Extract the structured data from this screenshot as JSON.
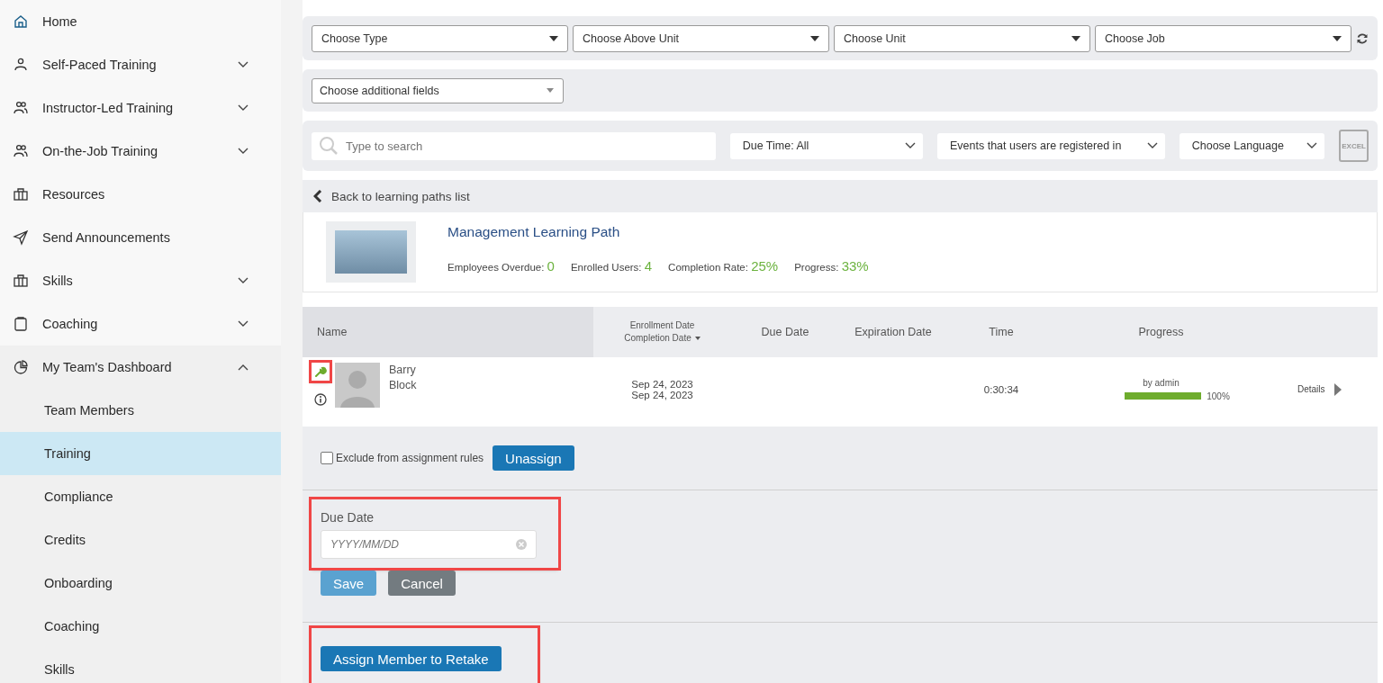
{
  "sidebar": {
    "items": [
      {
        "label": "Home",
        "kind": "link"
      },
      {
        "label": "Self-Paced Training",
        "kind": "group",
        "expanded": false
      },
      {
        "label": "Instructor-Led Training",
        "kind": "group",
        "expanded": false
      },
      {
        "label": "On-the-Job Training",
        "kind": "group",
        "expanded": false
      },
      {
        "label": "Resources",
        "kind": "link"
      },
      {
        "label": "Send Announcements",
        "kind": "link"
      },
      {
        "label": "Skills",
        "kind": "group",
        "expanded": false
      },
      {
        "label": "Coaching",
        "kind": "group",
        "expanded": false
      },
      {
        "label": "My Team's Dashboard",
        "kind": "group",
        "expanded": true,
        "children": [
          {
            "label": "Team Members",
            "selected": false
          },
          {
            "label": "Training",
            "selected": true
          },
          {
            "label": "Compliance",
            "selected": false
          },
          {
            "label": "Credits",
            "selected": false
          },
          {
            "label": "Onboarding",
            "selected": false
          },
          {
            "label": "Coaching",
            "selected": false
          },
          {
            "label": "Skills",
            "selected": false
          }
        ]
      }
    ]
  },
  "filters": [
    "Choose Type",
    "Choose Above Unit",
    "Choose Unit",
    "Choose Job"
  ],
  "additional_fields": "Choose additional fields",
  "search": {
    "placeholder": "Type to search"
  },
  "selects": [
    "Due Time: All",
    "Events that users are registered in",
    "Choose Language"
  ],
  "export_label": "EXCEL",
  "back_link": "Back to learning paths list",
  "path": {
    "title": "Management Learning Path",
    "stats": [
      {
        "label": "Employees Overdue:",
        "value": "0"
      },
      {
        "label": "Enrolled Users:",
        "value": "4"
      },
      {
        "label": "Completion Rate:",
        "value": "25%"
      },
      {
        "label": "Progress:",
        "value": "33%"
      }
    ]
  },
  "table": {
    "columns": [
      {
        "label": "Name"
      },
      {
        "label": "Enrollment Date",
        "label_2": "Completion Date",
        "sorted": true
      },
      {
        "label": "Due Date"
      },
      {
        "label": "Expiration Date"
      },
      {
        "label": "Time"
      },
      {
        "label": "Progress"
      }
    ],
    "row": {
      "first_name": "Barry",
      "last_name": "Block",
      "highlighted": true,
      "enrollment_date": "Sep 24, 2023",
      "completion_date": "Sep 24, 2023",
      "time": "0:30:34",
      "progress_by": "by admin",
      "level": 1,
      "reading": "100%",
      "details": "Details"
    }
  },
  "assignment": {
    "exclude_label": "Exclude from assignment rules",
    "checked": false,
    "unassign": "Unassign"
  },
  "due_date": {
    "label": "Due Date",
    "placeholder": "YYYY/MM/DD",
    "highlighted": true,
    "save": "Save",
    "cancel": "Cancel"
  },
  "retake": {
    "button": "Assign Member to Retake",
    "highlighted": true
  }
}
